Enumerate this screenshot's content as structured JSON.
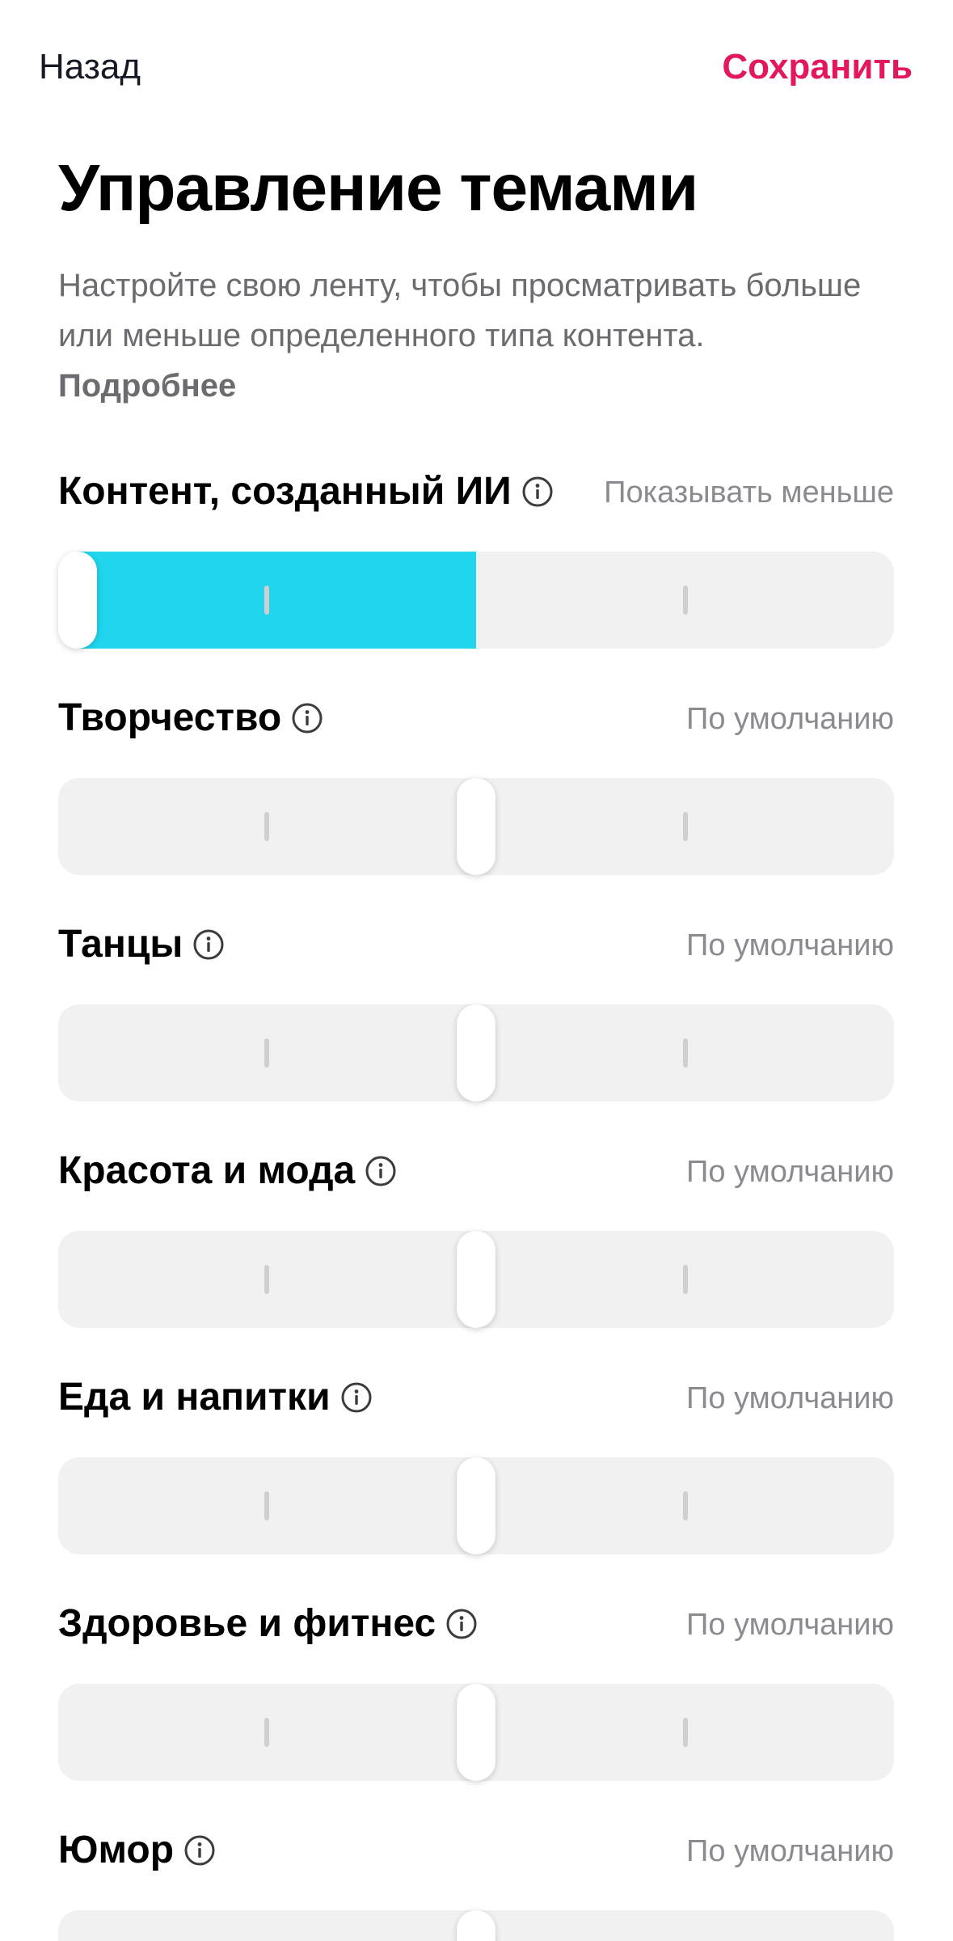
{
  "nav": {
    "back_label": "Назад",
    "save_label": "Сохранить"
  },
  "page_title": "Управление темами",
  "description": {
    "text": "Настройте свою ленту, чтобы просматривать больше или меньше определенного типа контента.",
    "learn_more": "Подробнее"
  },
  "colors": {
    "accent": "#e3175b",
    "slider_fill": "#20d5ec",
    "track": "#f1f1f2"
  },
  "slider_levels": 5,
  "topics": [
    {
      "title": "Контент, созданный ИИ",
      "value": "Показывать меньше",
      "level": 0,
      "filled": true
    },
    {
      "title": "Творчество",
      "value": "По умолчанию",
      "level": 2,
      "filled": false
    },
    {
      "title": "Танцы",
      "value": "По умолчанию",
      "level": 2,
      "filled": false
    },
    {
      "title": "Красота и мода",
      "value": "По умолчанию",
      "level": 2,
      "filled": false
    },
    {
      "title": "Еда и напитки",
      "value": "По умолчанию",
      "level": 2,
      "filled": false
    },
    {
      "title": "Здоровье и фитнес",
      "value": "По умолчанию",
      "level": 2,
      "filled": false
    },
    {
      "title": "Юмор",
      "value": "По умолчанию",
      "level": 2,
      "filled": false
    }
  ]
}
